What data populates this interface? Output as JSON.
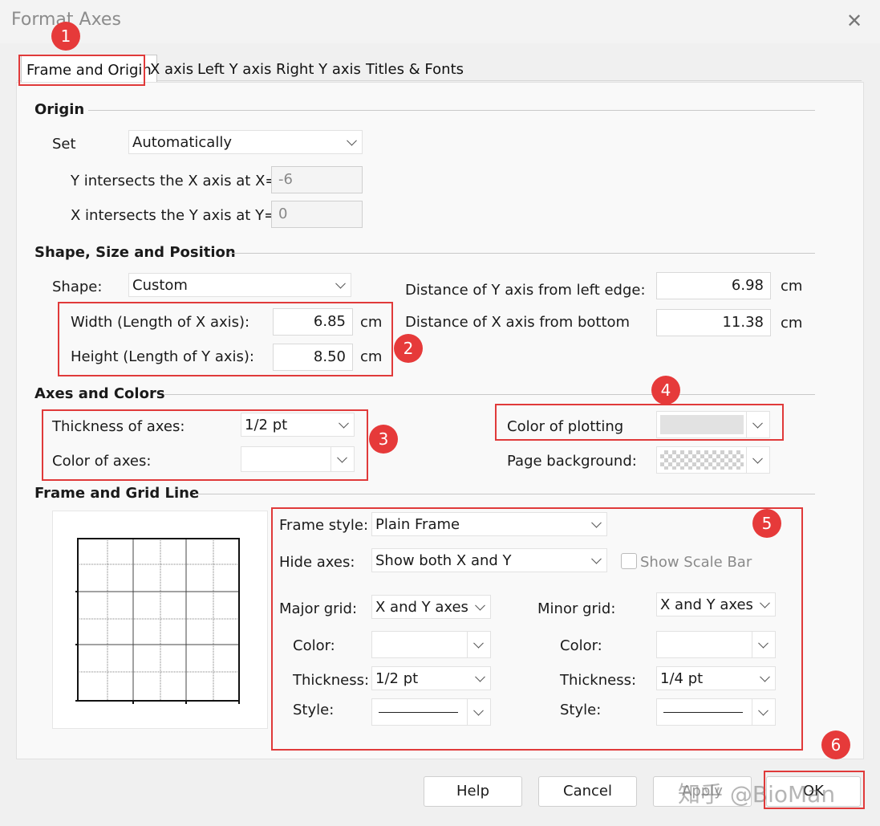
{
  "window": {
    "title": "Format Axes"
  },
  "tabs": [
    "Frame and Origin",
    "X axis",
    "Left Y axis",
    "Right Y axis",
    "Titles & Fonts"
  ],
  "origin": {
    "section": "Origin",
    "set_label": "Set",
    "set_value": "Automatically",
    "y_intersect_label": "Y intersects the X axis at X=",
    "y_intersect_value": "-6",
    "x_intersect_label": "X intersects the Y axis at Y=",
    "x_intersect_value": "0"
  },
  "shape": {
    "section": "Shape, Size and Position",
    "shape_label": "Shape:",
    "shape_value": "Custom",
    "width_label": "Width (Length of X axis):",
    "width_value": "6.85",
    "height_label": "Height (Length of Y axis):",
    "height_value": "8.50",
    "dist_y_label": "Distance of Y axis from left edge:",
    "dist_y_value": "6.98",
    "dist_x_label": "Distance of X axis from bottom",
    "dist_x_value": "11.38",
    "unit": "cm"
  },
  "axes_colors": {
    "section": "Axes and Colors",
    "thickness_label": "Thickness of axes:",
    "thickness_value": "1/2 pt",
    "color_axes_label": "Color of axes:",
    "color_plotting_label": "Color of plotting",
    "page_bg_label": "Page background:"
  },
  "frame_grid": {
    "section": "Frame and Grid Line",
    "frame_style_label": "Frame style:",
    "frame_style_value": "Plain Frame",
    "hide_axes_label": "Hide axes:",
    "hide_axes_value": "Show both X and Y",
    "show_scale_bar_label": "Show Scale Bar",
    "major_grid_label": "Major grid:",
    "major_grid_value": "X and Y axes",
    "minor_grid_label": "Minor grid:",
    "minor_grid_value": "X and Y axes",
    "color_label": "Color:",
    "thickness_label": "Thickness:",
    "major_thickness_value": "1/2 pt",
    "minor_thickness_value": "1/4 pt",
    "style_label": "Style:"
  },
  "annotations": [
    "1",
    "2",
    "3",
    "4",
    "5",
    "6"
  ],
  "buttons": {
    "help": "Help",
    "cancel": "Cancel",
    "apply": "Apply",
    "ok": "OK"
  },
  "watermark": "知乎 @BioMan",
  "colors": {
    "annotation_red": "#e03a3a",
    "plot_color": "#e2e2e2"
  },
  "icons": [
    "close-icon",
    "chevron-down-icon",
    "checkerboard-swatch",
    "checkbox"
  ]
}
